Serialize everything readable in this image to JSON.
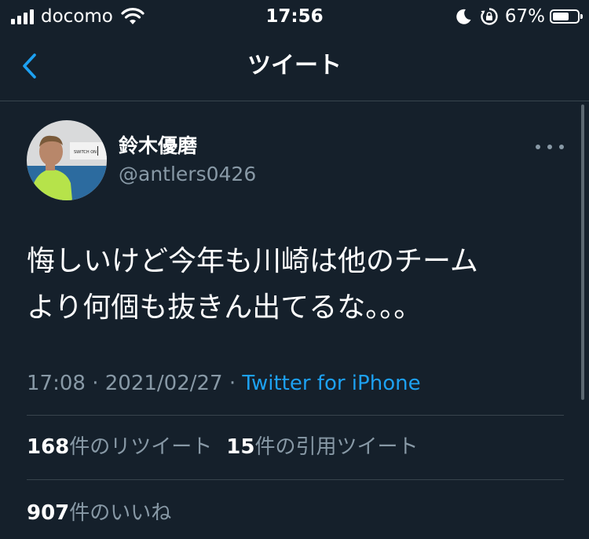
{
  "status_bar": {
    "carrier": "docomo",
    "time": "17:56",
    "battery_percent": "67%",
    "battery_level": 0.67,
    "icons": [
      "signal-icon",
      "wifi-icon",
      "moon-icon",
      "rotation-lock-icon",
      "battery-icon"
    ]
  },
  "nav": {
    "back_icon": "chevron-left-icon",
    "title": "ツイート"
  },
  "tweet": {
    "display_name": "鈴木優磨",
    "handle": "@antlers0426",
    "more_icon": "more-horizontal-icon",
    "text_line1": "悔しいけど今年も川崎は他のチーム",
    "text_line2": "より何個も抜きん出てるな。。。",
    "time": "17:08",
    "separator": "·",
    "date": "2021/02/27",
    "source": "Twitter for iPhone",
    "retweets_count": "168",
    "retweets_label": "件のリツイート",
    "quotes_count": "15",
    "quotes_label": "件の引用ツイート",
    "likes_count": "907",
    "likes_label": "件のいいね"
  },
  "colors": {
    "background": "#15202b",
    "accent": "#1da1f2",
    "secondary_text": "#8899a6",
    "divider": "#38444d"
  }
}
